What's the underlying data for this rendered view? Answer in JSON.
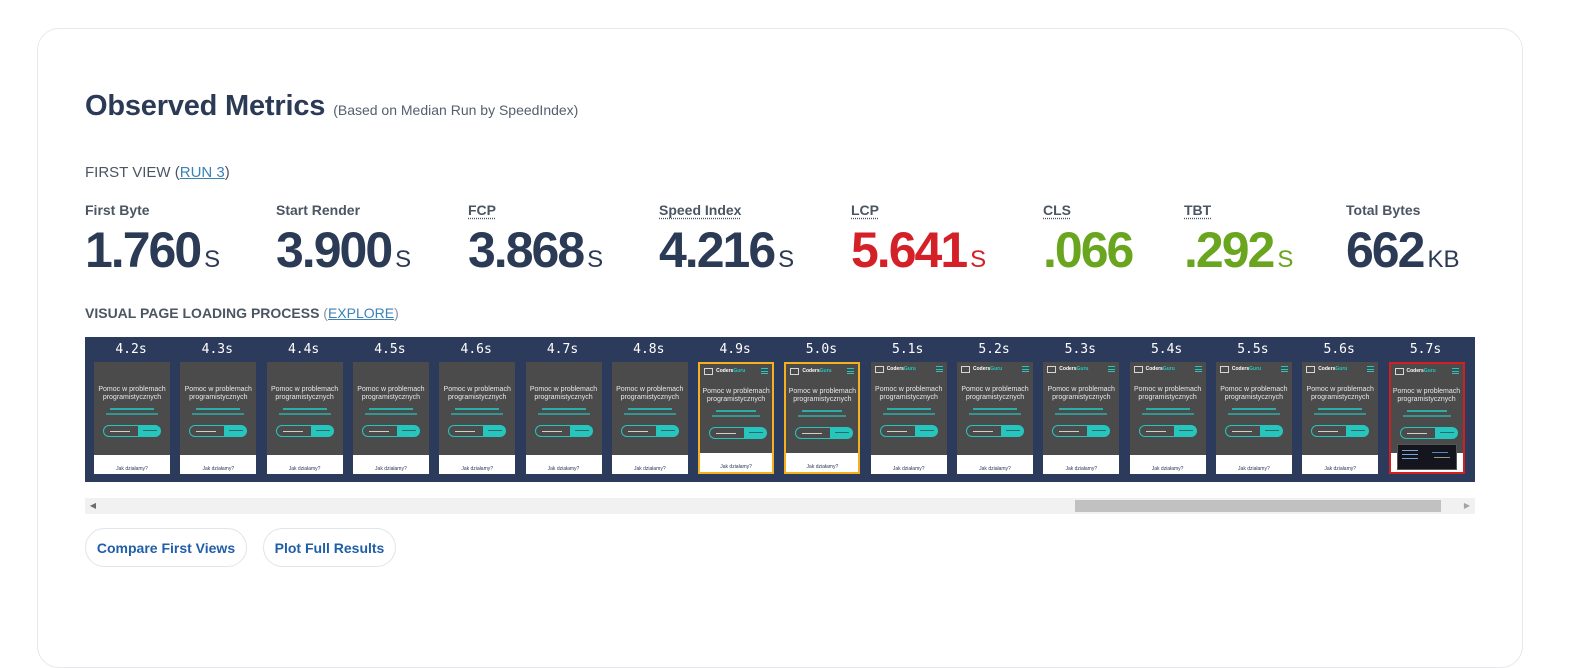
{
  "header": {
    "title": "Observed Metrics",
    "subtitle": "(Based on Median Run by SpeedIndex)"
  },
  "first_view": {
    "prefix": "FIRST VIEW (",
    "run_link": "RUN 3",
    "suffix": ")"
  },
  "metrics": [
    {
      "label": "First Byte",
      "value": "1.760",
      "unit": "S"
    },
    {
      "label": "Start Render",
      "value": "3.900",
      "unit": "S"
    },
    {
      "label": "FCP",
      "value": "3.868",
      "unit": "S"
    },
    {
      "label": "Speed Index",
      "value": "4.216",
      "unit": "S"
    },
    {
      "label": "LCP",
      "value": "5.641",
      "unit": "S"
    },
    {
      "label": "CLS",
      "value": ".066",
      "unit": ""
    },
    {
      "label": "TBT",
      "value": ".292",
      "unit": "S"
    },
    {
      "label": "Total Bytes",
      "value": "662",
      "unit": "KB"
    }
  ],
  "colors": {
    "default_metric": "#2b3a55",
    "lcp_red": "#d42027",
    "good_green": "#6aa51f",
    "filmstrip_bg": "#2c3a5c",
    "accent_teal": "#26c6bf",
    "highlight_yellow": "#f5b01e",
    "highlight_red": "#d41f1f",
    "link_blue": "#3b82b6"
  },
  "visual_loading": {
    "label": "VISUAL PAGE LOADING PROCESS",
    "open": "(",
    "link": "EXPLORE",
    "close": ")"
  },
  "filmstrip": {
    "headline": "Pomoc w problemach programistycznych",
    "logo_text_a": "Coders",
    "logo_text_b": "Guru",
    "bottom_text": "Jak działamy?",
    "frames": [
      {
        "time": "4.2s",
        "logo": false,
        "highlight": "none",
        "final": false
      },
      {
        "time": "4.3s",
        "logo": false,
        "highlight": "none",
        "final": false
      },
      {
        "time": "4.4s",
        "logo": false,
        "highlight": "none",
        "final": false
      },
      {
        "time": "4.5s",
        "logo": false,
        "highlight": "none",
        "final": false
      },
      {
        "time": "4.6s",
        "logo": false,
        "highlight": "none",
        "final": false
      },
      {
        "time": "4.7s",
        "logo": false,
        "highlight": "none",
        "final": false
      },
      {
        "time": "4.8s",
        "logo": false,
        "highlight": "none",
        "final": false
      },
      {
        "time": "4.9s",
        "logo": true,
        "highlight": "yellow",
        "final": false
      },
      {
        "time": "5.0s",
        "logo": true,
        "highlight": "yellow",
        "final": false
      },
      {
        "time": "5.1s",
        "logo": true,
        "highlight": "none",
        "final": false
      },
      {
        "time": "5.2s",
        "logo": true,
        "highlight": "none",
        "final": false
      },
      {
        "time": "5.3s",
        "logo": true,
        "highlight": "none",
        "final": false
      },
      {
        "time": "5.4s",
        "logo": true,
        "highlight": "none",
        "final": false
      },
      {
        "time": "5.5s",
        "logo": true,
        "highlight": "none",
        "final": false
      },
      {
        "time": "5.6s",
        "logo": true,
        "highlight": "none",
        "final": false
      },
      {
        "time": "5.7s",
        "logo": true,
        "highlight": "red",
        "final": true
      }
    ]
  },
  "scrollbar": {
    "left_arrow": "◀",
    "right_arrow": "▶",
    "thumb_start_fraction": 0.717,
    "thumb_size_fraction": 0.27
  },
  "buttons": {
    "compare": "Compare First Views",
    "plot": "Plot Full Results"
  }
}
